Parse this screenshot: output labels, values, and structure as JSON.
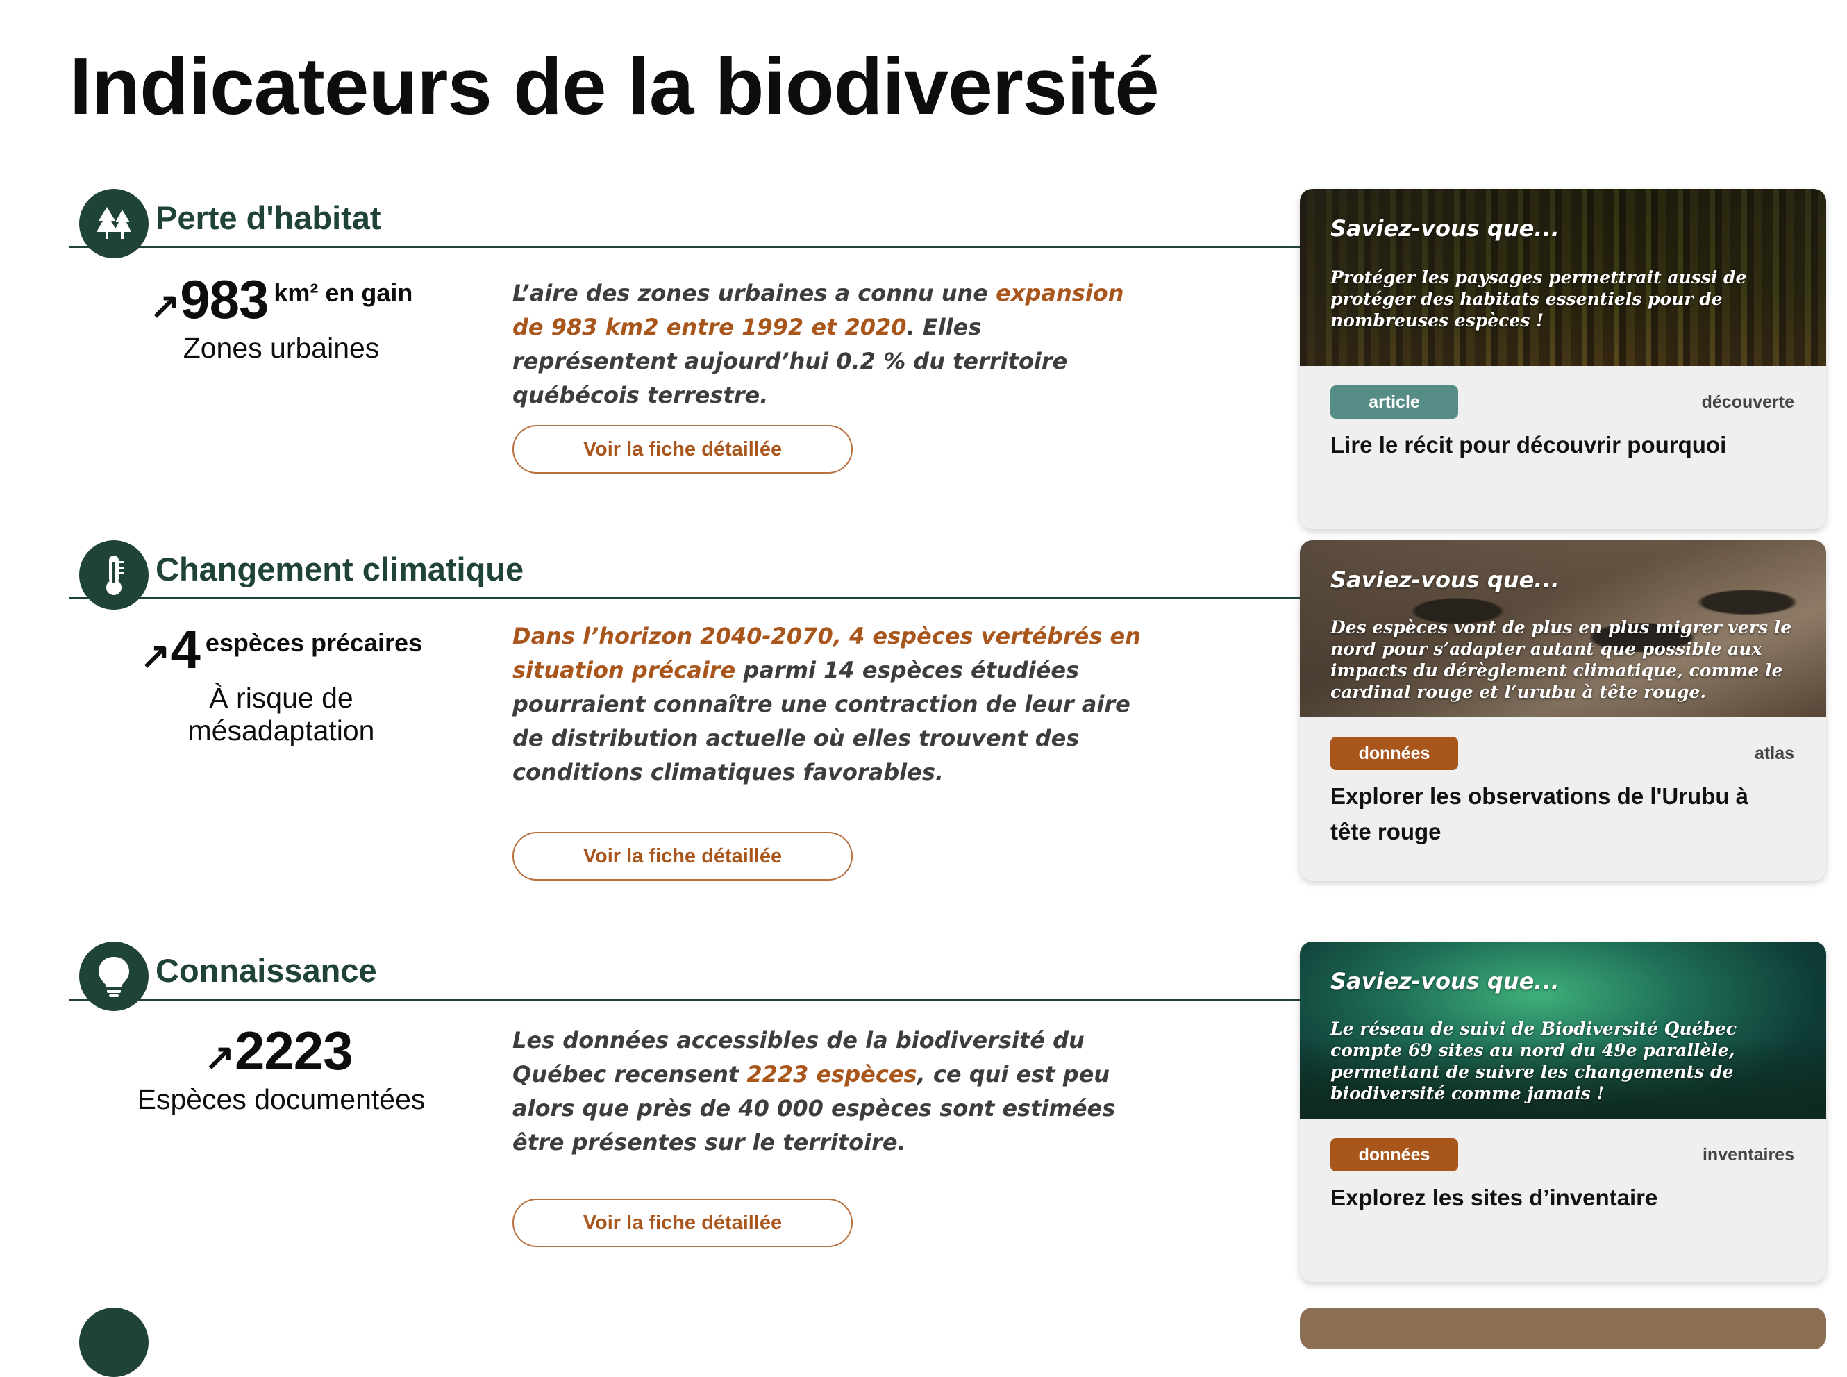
{
  "page": {
    "title": "Indicateurs de la biodiversité"
  },
  "colors": {
    "primary": "#1f4337",
    "accent": "#a9561c",
    "article_badge": "#568c86",
    "data_badge": "#a9561c"
  },
  "sections": [
    {
      "icon": "trees-icon",
      "title": "Perte d'habitat",
      "stat": {
        "arrow": "↗",
        "value": "983",
        "unit": "km² en gain",
        "label": "Zones urbaines"
      },
      "description": {
        "before": "L’aire des zones urbaines a connu une ",
        "highlight": "expansion de 983 km2 entre 1992 et 2020",
        "after": ". Elles représentent aujourd’hui 0.2 % du territoire québécois terrestre."
      },
      "button": "Voir la fiche détaillée",
      "card": {
        "question": "Saviez-vous que...",
        "text": "Protéger les paysages permettrait aussi de protéger des habitats essentiels pour de nombreuses espèces !",
        "badge": "article",
        "category": "découverte",
        "link": "Lire le récit pour découvrir pourquoi"
      }
    },
    {
      "icon": "thermometer-icon",
      "title": "Changement climatique",
      "stat": {
        "arrow": "↗",
        "value": "4",
        "unit": "espèces précaires",
        "label": "À risque de mésadaptation"
      },
      "description": {
        "before": "",
        "highlight": "Dans l’horizon 2040-2070, 4 espèces vertébrés en situation précaire",
        "after": " parmi 14 espèces étudiées pourraient connaître une contraction de leur aire de distribution actuelle où elles trouvent des conditions climatiques favorables."
      },
      "button": "Voir la fiche détaillée",
      "card": {
        "question": "Saviez-vous que...",
        "text": "Des espèces vont de plus en plus migrer vers le nord pour s’adapter autant que possible aux impacts du dérèglement climatique, comme le cardinal rouge et l’urubu à tête rouge.",
        "badge": "données",
        "category": "atlas",
        "link": "Explorer les observations de l'Urubu à tête rouge"
      }
    },
    {
      "icon": "lightbulb-icon",
      "title": "Connaissance",
      "stat": {
        "arrow": "↗",
        "value": "2223",
        "unit": "",
        "label": "Espèces documentées"
      },
      "description": {
        "before": "Les données accessibles de la biodiversité du Québec recensent ",
        "highlight": "2223 espèces",
        "after": ", ce qui est peu alors que près de 40 000 espèces sont estimées être présentes sur le territoire."
      },
      "button": "Voir la fiche détaillée",
      "card": {
        "question": "Saviez-vous que...",
        "text": "Le réseau de suivi de Biodiversité Québec compte 69 sites au nord du 49e parallèle, permettant de suivre les changements de biodiversité comme jamais !",
        "badge": "données",
        "category": "inventaires",
        "link": "Explorez les sites d’inventaire"
      }
    }
  ]
}
